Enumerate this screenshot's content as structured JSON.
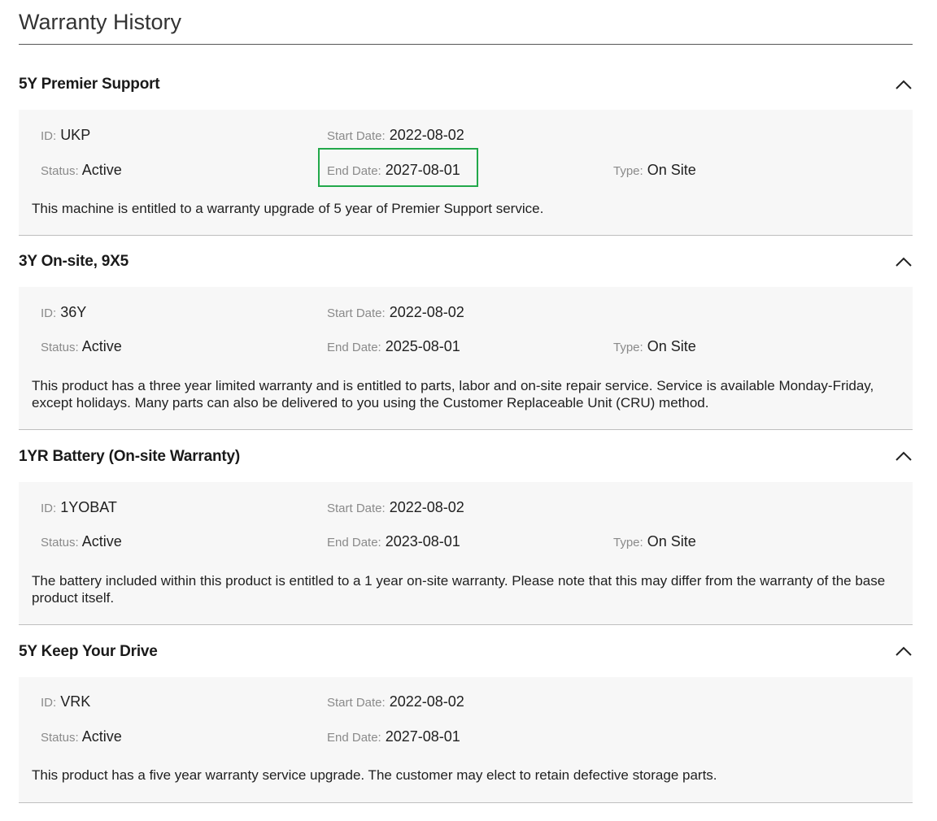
{
  "page": {
    "title": "Warranty History"
  },
  "labels": {
    "id": "ID",
    "start_date": "Start Date",
    "end_date": "End Date",
    "status": "Status",
    "type": "Type",
    "separator": ":"
  },
  "sections": [
    {
      "title": "5Y Premier Support",
      "id": "UKP",
      "start_date": "2022-08-02",
      "status": "Active",
      "end_date": "2027-08-01",
      "type": "On Site",
      "description": "This machine is entitled to a warranty upgrade of 5 year of Premier Support service."
    },
    {
      "title": "3Y On-site, 9X5",
      "id": "36Y",
      "start_date": "2022-08-02",
      "status": "Active",
      "end_date": "2025-08-01",
      "type": "On Site",
      "description": "This product has a three year limited warranty and is entitled to parts, labor and on-site repair service. Service is available Monday-Friday, except holidays. Many parts can also be delivered to you using the Customer Replaceable Unit (CRU) method."
    },
    {
      "title": "1YR Battery (On-site Warranty)",
      "id": "1YOBAT",
      "start_date": "2022-08-02",
      "status": "Active",
      "end_date": "2023-08-01",
      "type": "On Site",
      "description": "The battery included within this product is entitled to a 1 year on-site warranty. Please note that this may differ from the warranty of the base product itself."
    },
    {
      "title": "5Y Keep Your Drive",
      "id": "VRK",
      "start_date": "2022-08-02",
      "status": "Active",
      "end_date": "2027-08-01",
      "description": "This product has a five year warranty service upgrade. The customer may elect to retain defective storage parts."
    }
  ],
  "icons": {
    "collapse": "chevron-up-icon"
  },
  "colors": {
    "highlight": "#22a84a",
    "panel_bg": "#f7f7f7",
    "label": "#8a8a8a"
  }
}
